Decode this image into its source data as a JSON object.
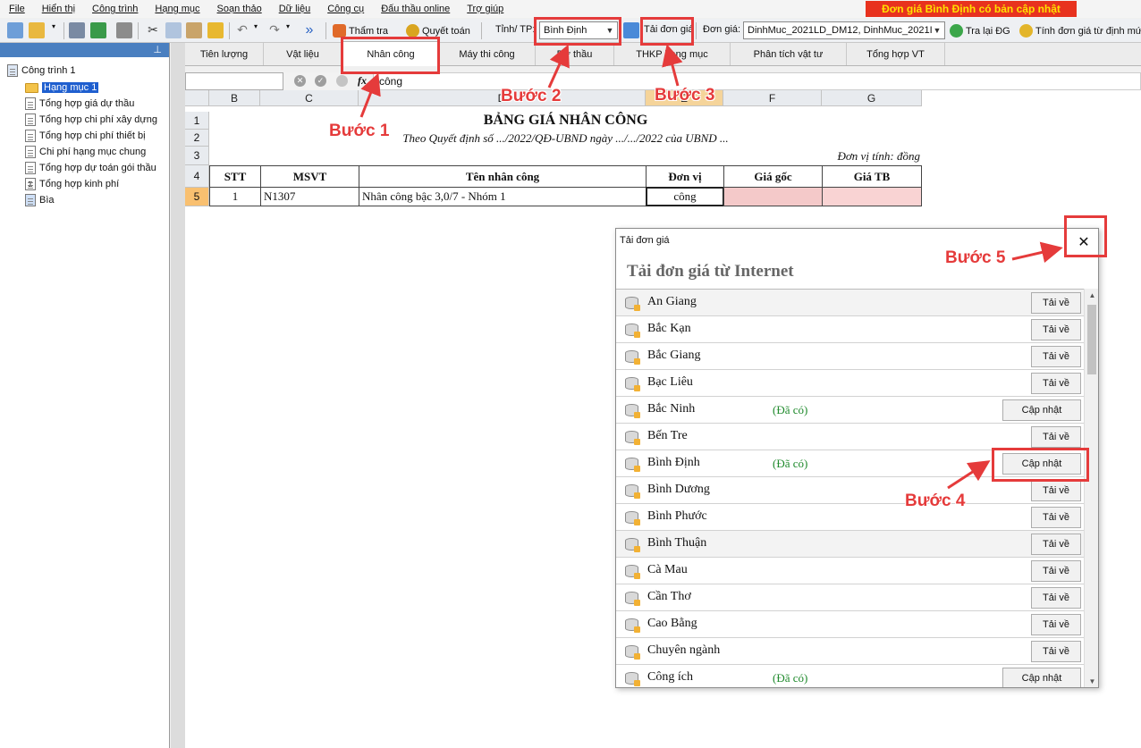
{
  "menu": [
    "File",
    "Hiển thị",
    "Công trình",
    "Hạng mục",
    "Soạn thảo",
    "Dữ liệu",
    "Công cụ",
    "Đấu thầu online",
    "Trợ giúp"
  ],
  "banner": "Đơn giá Bình Định có bản cập nhật",
  "toolbar": {
    "tham_tra": "Thẩm tra",
    "quyet_toan": "Quyết toán",
    "tinh_label": "Tỉnh/ TP:",
    "tinh_value": "Bình Định",
    "tai_don_gia": "Tải đơn giá",
    "don_gia_label": "Đơn giá:",
    "don_gia_value": "DinhMuc_2021LD_DM12, DinhMuc_2021I",
    "tra_lai": "Tra lại ĐG",
    "tinh_dg": "Tính đơn giá từ định mức"
  },
  "tree": {
    "root": "Công trình 1",
    "items": [
      "Hạng mục 1",
      "Tổng hợp giá dự thầu",
      "Tổng hợp chi phí xây dựng",
      "Tổng hợp chi phí thiết bị",
      "Chi phí hạng mục chung",
      "Tổng hợp dự toán gói thầu",
      "Tổng hợp kinh phí",
      "Bìa"
    ]
  },
  "tabs": [
    "Tiên lượng",
    "Vật liệu",
    "Nhân công",
    "Máy thi công",
    "Dự thầu",
    "THKP hạng mục",
    "Phân tích vật tư",
    "Tổng hợp VT"
  ],
  "formula": {
    "fx": "fx",
    "value": "công"
  },
  "sheet": {
    "columns": [
      "B",
      "C",
      "D",
      "E",
      "F",
      "G"
    ],
    "rows": [
      "1",
      "2",
      "3",
      "4",
      "5"
    ],
    "title": "BẢNG GIÁ NHÂN CÔNG",
    "subtitle": "Theo Quyết định số .../2022/QĐ-UBND ngày .../.../2022 của UBND ...",
    "unit": "Đơn vị tính: đồng",
    "headers": [
      "STT",
      "MSVT",
      "Tên nhân công",
      "Đơn vị",
      "Giá gốc",
      "Giá TB"
    ],
    "row": [
      "1",
      "N1307",
      "Nhân công bậc 3,0/7 - Nhóm 1",
      "công",
      "",
      ""
    ]
  },
  "dialog": {
    "title": "Tải đơn giá",
    "heading": "Tải đơn giá từ Internet",
    "download_label": "Tải về",
    "update_label": "Cập nhật",
    "have_label": "(Đã có)",
    "provinces": [
      {
        "name": "An Giang",
        "has": false
      },
      {
        "name": "Bắc Kạn",
        "has": false
      },
      {
        "name": "Bắc Giang",
        "has": false
      },
      {
        "name": "Bạc Liêu",
        "has": false
      },
      {
        "name": "Bắc Ninh",
        "has": true
      },
      {
        "name": "Bến Tre",
        "has": false
      },
      {
        "name": "Bình Định",
        "has": true
      },
      {
        "name": "Bình Dương",
        "has": false
      },
      {
        "name": "Bình Phước",
        "has": false
      },
      {
        "name": "Bình Thuận",
        "has": false
      },
      {
        "name": "Cà Mau",
        "has": false
      },
      {
        "name": "Cần Thơ",
        "has": false
      },
      {
        "name": "Cao Bằng",
        "has": false
      },
      {
        "name": "Chuyên ngành",
        "has": false
      },
      {
        "name": "Công ích",
        "has": true
      }
    ]
  },
  "steps": [
    "Bước 1",
    "Bước 2",
    "Bước 3",
    "Bước 4",
    "Bước 5"
  ],
  "colors": {
    "annotation": "#e53b3b",
    "banner_bg": "#e8321e",
    "banner_text": "#ffe000",
    "selected": "#1f5fcf",
    "have_status": "#1f8a2c",
    "cell_pink": "#f4c9c9"
  }
}
